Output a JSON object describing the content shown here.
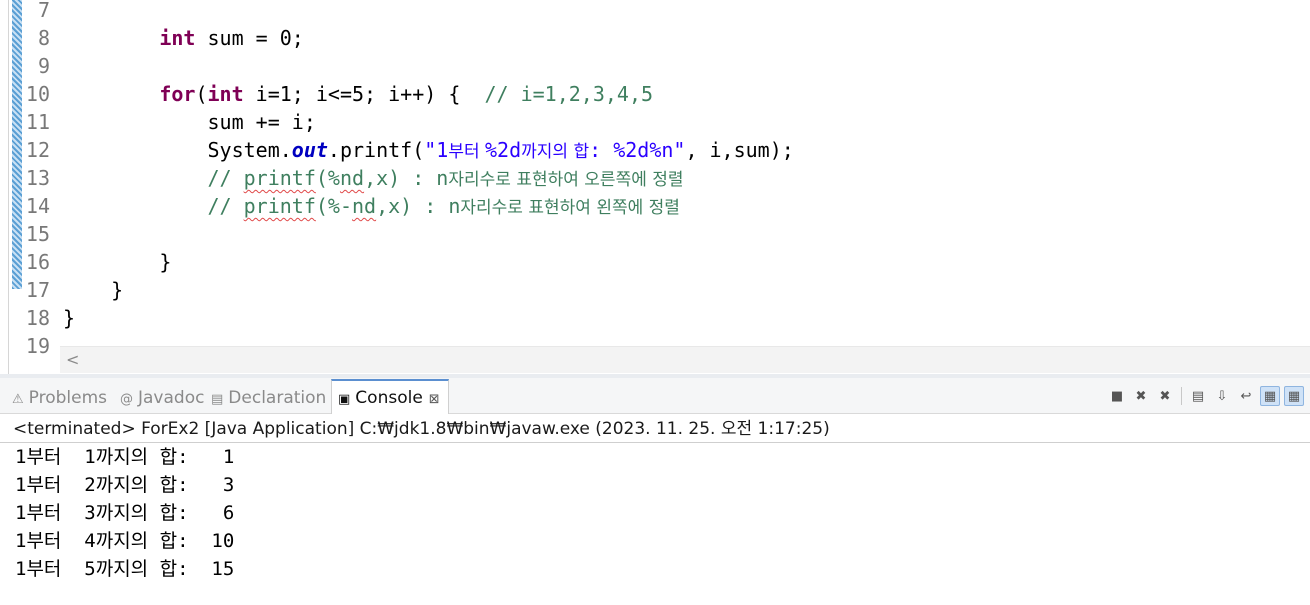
{
  "editor": {
    "lines": [
      {
        "num": "7",
        "segments": []
      },
      {
        "num": "8",
        "segments": [
          {
            "t": "        ",
            "c": ""
          },
          {
            "t": "int",
            "c": "kw"
          },
          {
            "t": " sum = 0;",
            "c": ""
          }
        ]
      },
      {
        "num": "9",
        "segments": []
      },
      {
        "num": "10",
        "segments": [
          {
            "t": "        ",
            "c": ""
          },
          {
            "t": "for",
            "c": "kw"
          },
          {
            "t": "(",
            "c": ""
          },
          {
            "t": "int",
            "c": "kw"
          },
          {
            "t": " i=1; i<=5; i++) {  ",
            "c": ""
          },
          {
            "t": "// i=1,2,3,4,5",
            "c": "cm"
          }
        ]
      },
      {
        "num": "11",
        "segments": [
          {
            "t": "            sum += i;",
            "c": ""
          }
        ]
      },
      {
        "num": "12",
        "segments": [
          {
            "t": "            System.",
            "c": ""
          },
          {
            "t": "out",
            "c": "fld"
          },
          {
            "t": ".printf(",
            "c": ""
          },
          {
            "t": "\"1",
            "c": "str"
          },
          {
            "t": "부터 ",
            "c": "str ko"
          },
          {
            "t": "%2d",
            "c": "str"
          },
          {
            "t": "까지의 합",
            "c": "str ko"
          },
          {
            "t": ": %2d%n\"",
            "c": "str"
          },
          {
            "t": ", i,sum);",
            "c": ""
          }
        ]
      },
      {
        "num": "13",
        "segments": [
          {
            "t": "            ",
            "c": ""
          },
          {
            "t": "// ",
            "c": "cm"
          },
          {
            "t": "printf",
            "c": "cm sq"
          },
          {
            "t": "(%",
            "c": "cm"
          },
          {
            "t": "nd",
            "c": "cm sq"
          },
          {
            "t": ",x) : n",
            "c": "cm"
          },
          {
            "t": "자리수로 표현하여 오른쪽에 정렬",
            "c": "cm ko"
          }
        ]
      },
      {
        "num": "14",
        "segments": [
          {
            "t": "            ",
            "c": ""
          },
          {
            "t": "// ",
            "c": "cm"
          },
          {
            "t": "printf",
            "c": "cm sq"
          },
          {
            "t": "(%-",
            "c": "cm"
          },
          {
            "t": "nd",
            "c": "cm sq"
          },
          {
            "t": ",x) : n",
            "c": "cm"
          },
          {
            "t": "자리수로 표현하여 왼쪽에 정렬",
            "c": "cm ko"
          }
        ]
      },
      {
        "num": "15",
        "segments": []
      },
      {
        "num": "16",
        "segments": [
          {
            "t": "        }",
            "c": ""
          }
        ]
      },
      {
        "num": "17",
        "segments": [
          {
            "t": "    }",
            "c": ""
          }
        ]
      },
      {
        "num": "18",
        "segments": [
          {
            "t": "}",
            "c": ""
          }
        ]
      },
      {
        "num": "19",
        "segments": []
      }
    ],
    "scroll_left_glyph": "<"
  },
  "panel": {
    "tabs": [
      {
        "id": "problems",
        "label": "Problems",
        "icon_name": "problems-icon",
        "icon": "⚠"
      },
      {
        "id": "javadoc",
        "label": "Javadoc",
        "icon_name": "javadoc-icon",
        "icon": "@"
      },
      {
        "id": "declaration",
        "label": "Declaration",
        "icon_name": "declaration-icon",
        "icon": "▤"
      },
      {
        "id": "console",
        "label": "Console",
        "icon_name": "console-icon",
        "icon": "▣",
        "active": true,
        "close": "⊠"
      }
    ],
    "toolbar": [
      {
        "name": "terminate-icon",
        "glyph": "■"
      },
      {
        "name": "remove-launch-icon",
        "glyph": "✖"
      },
      {
        "name": "remove-all-terminated-icon",
        "glyph": "✖"
      },
      {
        "name": "separator"
      },
      {
        "name": "clear-console-icon",
        "glyph": "▤"
      },
      {
        "name": "scroll-lock-icon",
        "glyph": "⇩"
      },
      {
        "name": "word-wrap-icon",
        "glyph": "↩"
      },
      {
        "name": "pin-console-icon",
        "glyph": "▦",
        "active": true
      },
      {
        "name": "open-console-icon",
        "glyph": "▦",
        "active": true
      }
    ]
  },
  "console": {
    "status": "<terminated> ForEx2 [Java Application] C:₩jdk1.8₩bin₩javaw.exe  (2023. 11. 25. 오전 1:17:25)",
    "output": [
      "1부터  1까지의 합:   1",
      "1부터  2까지의 합:   3",
      "1부터  3까지의 합:   6",
      "1부터  4까지의 합:  10",
      "1부터  5까지의 합:  15"
    ]
  }
}
